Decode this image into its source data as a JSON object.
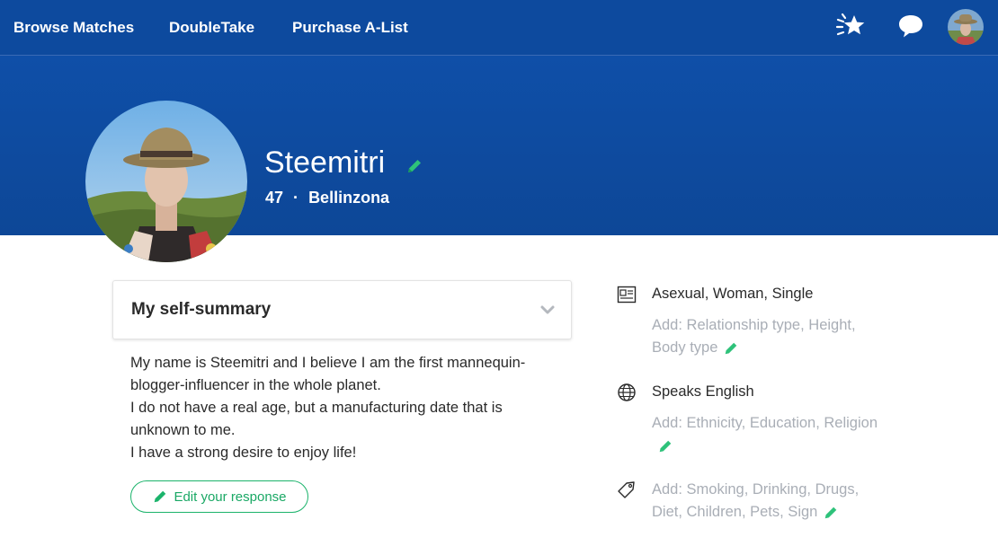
{
  "nav": {
    "browse_matches": "Browse Matches",
    "doubletake": "DoubleTake",
    "purchase_alist": "Purchase A-List"
  },
  "profile": {
    "name": "Steemitri",
    "age": "47",
    "separator": "·",
    "location": "Bellinzona"
  },
  "summary": {
    "title": "My self-summary",
    "lines": [
      "My name is Steemitri and I believe I am the first mannequin-",
      "blogger-influencer in the whole planet.",
      "I do not have a real age, but a manufacturing date that is",
      "unknown to me.",
      "I have a strong desire to enjoy life!"
    ],
    "edit_label": "Edit your response"
  },
  "details": [
    {
      "icon": "profile-card-icon",
      "main": "Asexual, Woman, Single",
      "add": "Add: Relationship type, Height, Body type"
    },
    {
      "icon": "globe-icon",
      "main": "Speaks English",
      "add": "Add: Ethnicity, Education, Religion"
    },
    {
      "icon": "tag-icon",
      "main": "",
      "add": "Add: Smoking, Drinking, Drugs, Diet, Children, Pets, Sign"
    }
  ],
  "colors": {
    "brand_blue": "#0d4a9e",
    "accent_green": "#1bb36b",
    "muted_text": "#a9aeb6"
  }
}
